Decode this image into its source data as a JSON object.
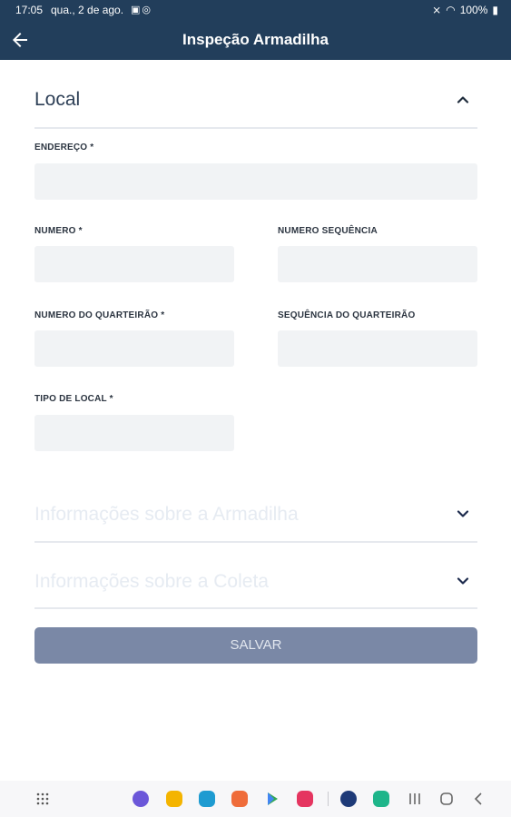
{
  "status_bar": {
    "time": "17:05",
    "date": "qua., 2 de ago.",
    "battery": "100%",
    "icons": [
      "gallery-icon",
      "whatsapp-icon",
      "mute-icon",
      "wifi-icon",
      "battery-icon"
    ]
  },
  "app_bar": {
    "title": "Inspeção Armadilha",
    "back_icon": "arrow-left-icon"
  },
  "sections": {
    "local": {
      "title": "Local",
      "expanded": true
    },
    "armadilha": {
      "title": "Informações sobre a Armadilha",
      "expanded": false
    },
    "coleta": {
      "title": "Informações sobre a Coleta",
      "expanded": false
    }
  },
  "form": {
    "endereco": {
      "label": "ENDEREÇO *",
      "value": ""
    },
    "numero": {
      "label": "NUMERO *",
      "value": ""
    },
    "numero_sequencia": {
      "label": "NUMERO SEQUÊNCIA",
      "value": ""
    },
    "numero_quarteirao": {
      "label": "NUMERO DO QUARTEIRÃO *",
      "value": ""
    },
    "sequencia_quarteirao": {
      "label": "SEQUÊNCIA DO QUARTEIRÃO",
      "value": ""
    },
    "tipo_local": {
      "label": "TIPO DE LOCAL *",
      "value": ""
    }
  },
  "actions": {
    "save_label": "SALVAR"
  },
  "nav_bar": {
    "apps": [
      "app-drawer-icon",
      "browser-icon",
      "notes-icon",
      "calendar-icon",
      "contacts-icon",
      "play-store-icon",
      "video-icon",
      "settings-icon",
      "messages-icon"
    ],
    "system": [
      "recents-icon",
      "home-icon",
      "back-icon"
    ]
  },
  "colors": {
    "app_bar": "#223e5b",
    "input_bg": "#f1f3f5",
    "save_button": "#7a88a6",
    "label_text": "#2b3440"
  }
}
